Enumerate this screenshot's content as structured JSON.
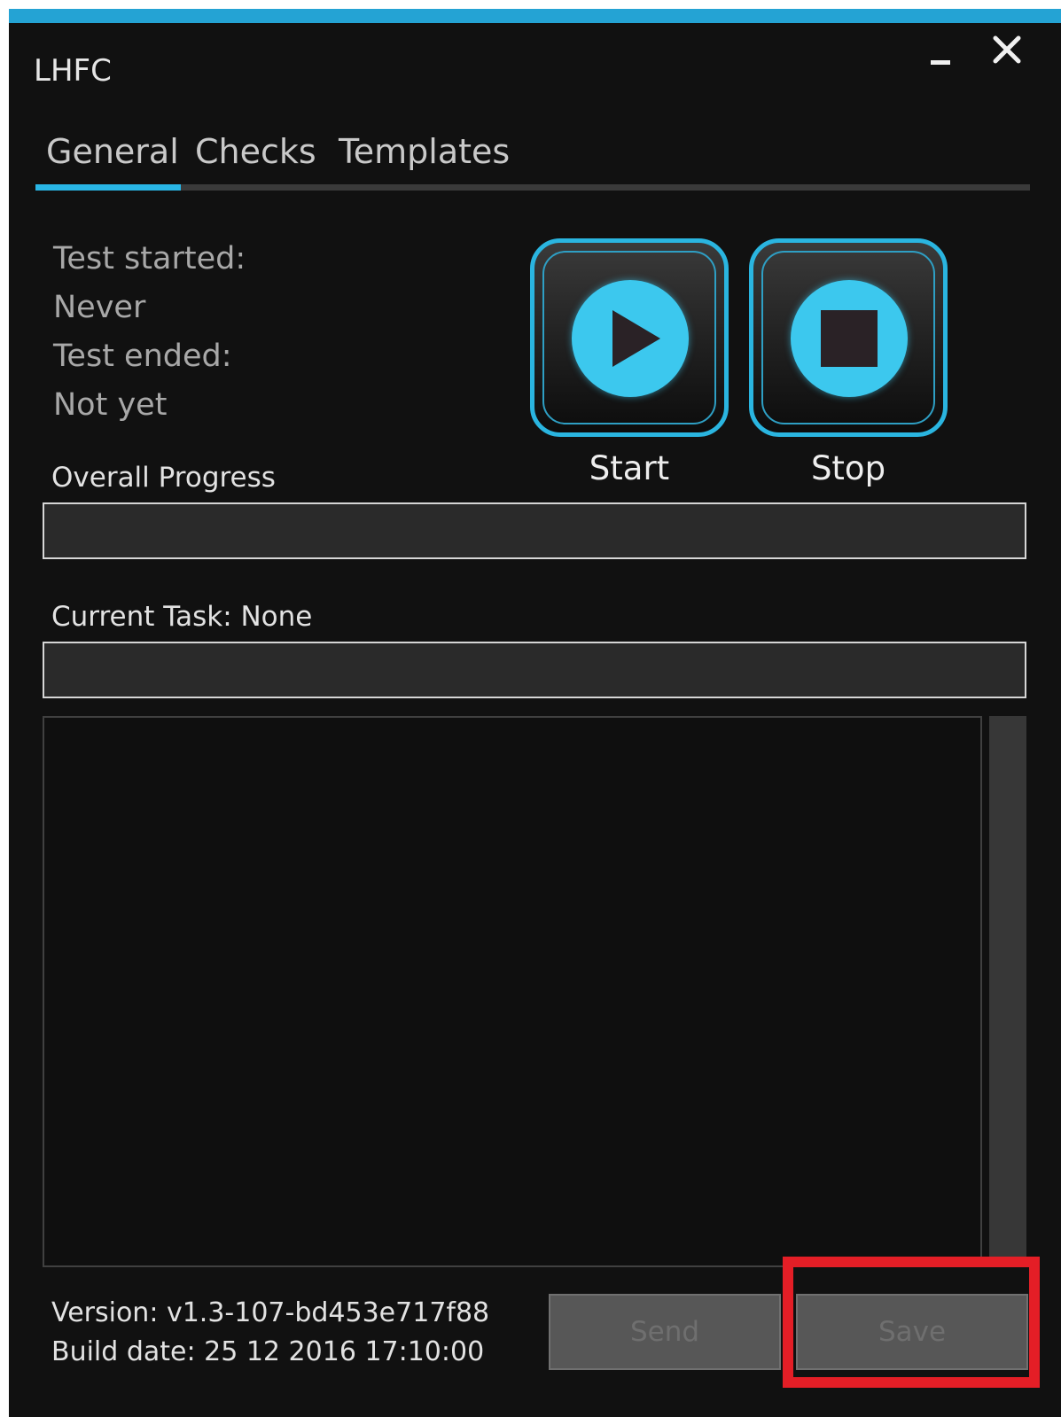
{
  "window": {
    "title": "LHFC",
    "accent_color": "#24a3d4"
  },
  "tabs": [
    {
      "label": "General",
      "selected": true
    },
    {
      "label": "Checks",
      "selected": false
    },
    {
      "label": "Templates",
      "selected": false
    }
  ],
  "test_info": {
    "started_label": "Test started:",
    "started_value": "Never",
    "ended_label": "Test ended:",
    "ended_value": "Not yet"
  },
  "controls": {
    "start_label": "Start",
    "stop_label": "Stop",
    "start_icon": "play-icon",
    "stop_icon": "stop-icon"
  },
  "progress": {
    "overall_label": "Overall Progress",
    "overall_value": 0,
    "current_task_label": "Current Task: None",
    "current_task_value": 0
  },
  "footer": {
    "version": "Version: v1.3-107-bd453e717f88",
    "build_date": "Build date: 25 12 2016 17:10:00",
    "send_label": "Send",
    "save_label": "Save"
  }
}
